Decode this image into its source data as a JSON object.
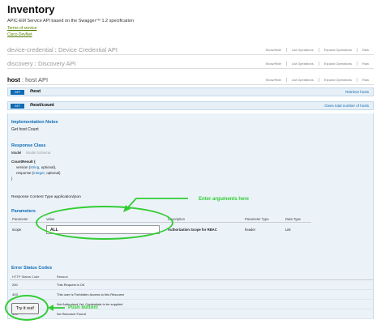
{
  "header": {
    "title": "Inventory",
    "subtitle": "APIC-EM Service API based on the Swagger™ 1.2 specification",
    "terms_link": "Terms of service",
    "devnet_link": "Cisco DevNet"
  },
  "api_sections": [
    {
      "name": "device-credential",
      "sep": " : ",
      "desc": "Device Credential API"
    },
    {
      "name": "discovery",
      "sep": " : ",
      "desc": "Discovery API"
    },
    {
      "name": "host",
      "sep": " : ",
      "desc": "host API"
    }
  ],
  "ops_links": [
    "Show/Hide",
    "List Operations",
    "Expand Operations",
    "Raw"
  ],
  "operations": [
    {
      "method": "GET",
      "path": "/host",
      "summary": "Retrieve hosts"
    },
    {
      "method": "GET",
      "path": "/host/count",
      "summary": "Gives total number of hosts"
    }
  ],
  "details": {
    "impl_notes_heading": "Implementation Notes",
    "impl_notes_text": "Get host Count",
    "response_class_heading": "Response Class",
    "model_tab": "Model",
    "model_schema_tab": "Model Schema",
    "model_name": "CountResult {",
    "model_line1_prefix": "version (",
    "model_line1_type": "string",
    "model_line1_suffix": ", optional),",
    "model_line2_prefix": "response (",
    "model_line2_type": "integer",
    "model_line2_suffix": ", optional)",
    "model_close": "}",
    "content_type_label": "Response Content Type",
    "content_type_value": "application/json",
    "parameters_heading": "Parameters",
    "param_headers": [
      "Parameter",
      "Value",
      "Description",
      "Parameter Type",
      "Data Type"
    ],
    "param_row": {
      "name": "scope",
      "value": "ALL",
      "description": "Authorization Scope for RBAC",
      "param_type": "header",
      "data_type": "List"
    },
    "error_heading": "Error Status Codes",
    "error_headers": [
      "HTTP Status Code",
      "Reason"
    ],
    "error_rows": [
      {
        "code": "200",
        "reason": "This Request is OK"
      },
      {
        "code": "403",
        "reason": "This user is Forbidden Access to this Resource"
      },
      {
        "code": "401",
        "reason": "Not Authorized Yet, Credentials to be supplied"
      },
      {
        "code": "404",
        "reason": "No Resource Found"
      }
    ],
    "try_button": "Try it out!"
  },
  "annotations": {
    "enter_args": "Enter arguments here",
    "push_button": "Push button!",
    "color": "#33cc33"
  }
}
